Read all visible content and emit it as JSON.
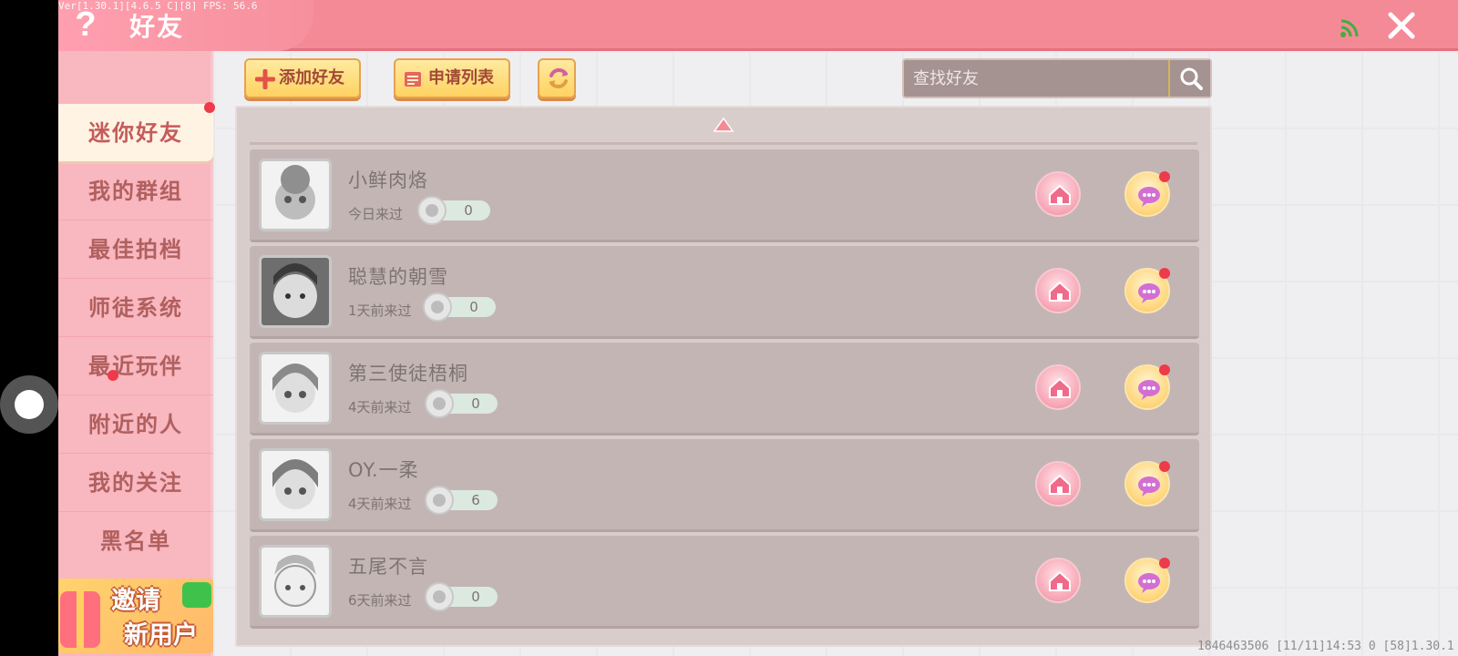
{
  "header": {
    "title": "好友",
    "version": "Ver[1.30.1][4.6.5 C][8] FPS: 56.6",
    "accent_color": "#f48a96"
  },
  "sidebar": {
    "items": [
      {
        "label": "迷你好友",
        "active": true,
        "badge": true
      },
      {
        "label": "我的群组"
      },
      {
        "label": "最佳拍档"
      },
      {
        "label": "师徒系统"
      },
      {
        "label": "最近玩伴",
        "badge": true
      },
      {
        "label": "附近的人"
      },
      {
        "label": "我的关注"
      },
      {
        "label": "黑名单"
      }
    ],
    "invite": {
      "line1": "邀请",
      "line2": "新用户"
    }
  },
  "toolbar": {
    "add_friend_label": "添加好友",
    "request_list_label": "申请列表"
  },
  "search": {
    "placeholder": "查找好友"
  },
  "friends": [
    {
      "name": "小鲜肉烙",
      "last_seen": "今日来过",
      "count": "0"
    },
    {
      "name": "聪慧的朝雪",
      "last_seen": "1天前来过",
      "count": "0"
    },
    {
      "name": "第三使徒梧桐",
      "last_seen": "4天前来过",
      "count": "0"
    },
    {
      "name": "OY.一柔",
      "last_seen": "4天前来过",
      "count": "6"
    },
    {
      "name": "五尾不言",
      "last_seen": "6天前来过",
      "count": "0"
    }
  ],
  "footer": {
    "info": "1846463506   [11/11]14:53 0  [58]1.30.1"
  }
}
